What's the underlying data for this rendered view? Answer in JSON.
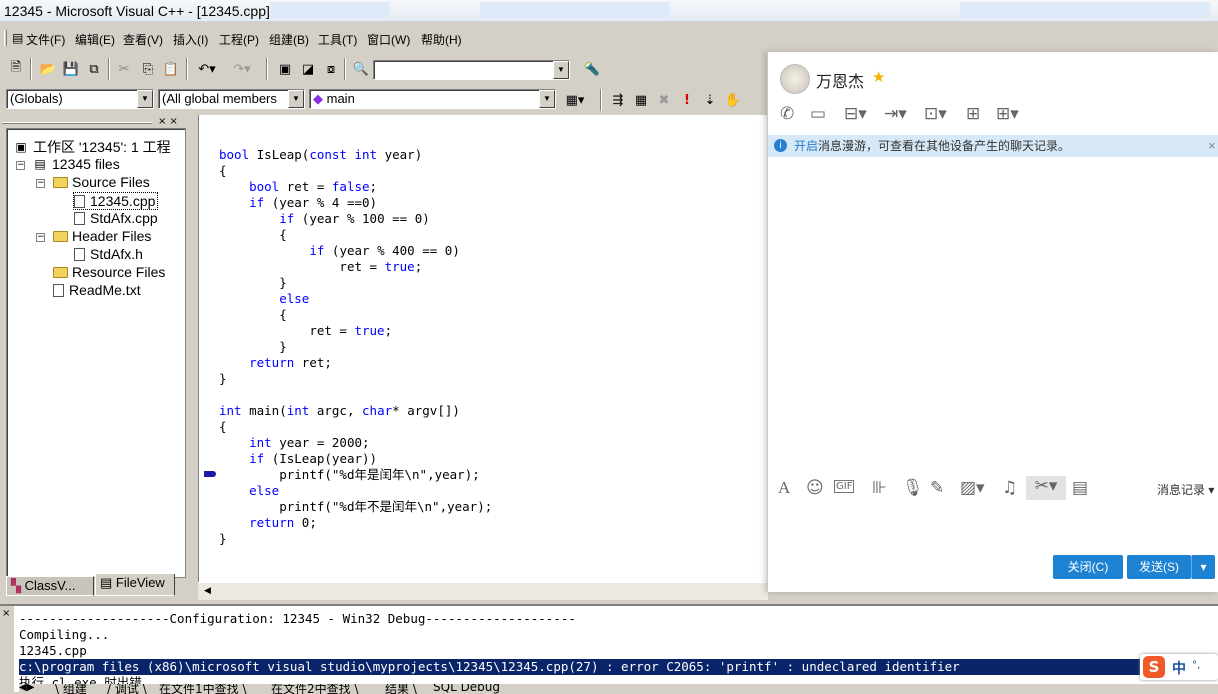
{
  "title": {
    "text": "12345 - Microsoft Visual C++ - [12345.cpp]"
  },
  "menu": [
    "文件(F)",
    "编辑(E)",
    "查看(V)",
    "插入(I)",
    "工程(P)",
    "组建(B)",
    "工具(T)",
    "窗口(W)",
    "帮助(H)"
  ],
  "combos": {
    "globals": "(Globals)",
    "members": "(All global members",
    "func": "main"
  },
  "workspace": {
    "root": "工作区 '12345': 1 工程",
    "project": "12345 files",
    "source_folder": "Source Files",
    "file_main": "12345.cpp",
    "file_stdafx_cpp": "StdAfx.cpp",
    "header_folder": "Header Files",
    "file_stdafx_h": "StdAfx.h",
    "resource_folder": "Resource Files",
    "file_readme": "ReadMe.txt",
    "tab_class": "ClassV...",
    "tab_file": "FileView"
  },
  "code": [
    "bool IsLeap(const int year)",
    "{",
    "    bool ret = false;",
    "    if (year % 4 ==0)",
    "        if (year % 100 == 0)",
    "        {",
    "            if (year % 400 == 0)",
    "                ret = true;",
    "        }",
    "        else",
    "        {",
    "            ret = true;",
    "        }",
    "    return ret;",
    "}",
    "",
    "int main(int argc, char* argv[])",
    "{",
    "    int year = 2000;",
    "    if (IsLeap(year))",
    "        printf(\"%d年是闰年\\n\",year);",
    "    else",
    "        printf(\"%d年不是闰年\\n\",year);",
    "    return 0;",
    "}"
  ],
  "chat": {
    "contact": "万恩杰",
    "notice_link": "开启",
    "notice_text": "消息漫游，可查看在其他设备产生的聊天记录。",
    "history": "消息记录",
    "close_btn": "关闭(C)",
    "send_btn": "发送(S)"
  },
  "output": {
    "lines": [
      "--------------------Configuration: 12345 - Win32 Debug--------------------",
      "Compiling...",
      "12345.cpp"
    ],
    "error": "c:\\program files (x86)\\microsoft visual studio\\myprojects\\12345\\12345.cpp(27) : error C2065: 'printf' : undeclared identifier",
    "last": "执行 cl.exe 时出错.",
    "tabs": [
      "组建",
      "调试",
      "在文件1中查找",
      "在文件2中查找",
      "结果",
      "SQL Debug"
    ]
  },
  "ime": {
    "mode": "中"
  }
}
